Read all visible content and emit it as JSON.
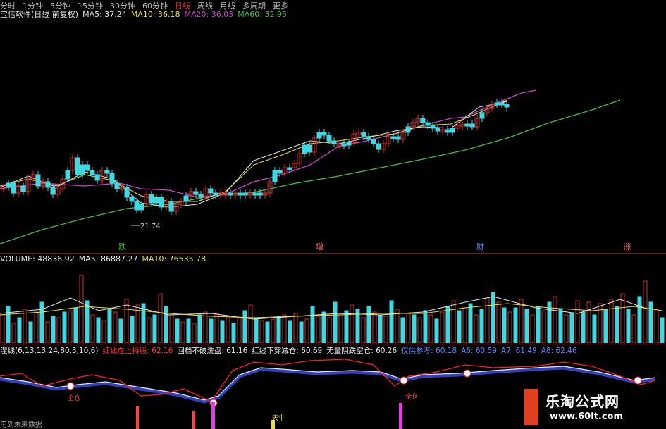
{
  "top_tabs": {
    "items": [
      "分时",
      "1分钟",
      "5分钟",
      "15分钟",
      "30分钟",
      "60分钟",
      "日线",
      "周线",
      "月线",
      "多周期",
      "更多"
    ],
    "selected": "日线"
  },
  "price_panel": {
    "title": "宝信软件(日线 前复权)",
    "ma5": "MA5: 37.24",
    "ma10": "MA10: 36.18",
    "ma20": "MA20: 36.03",
    "ma60": "MA60: 32.95",
    "low_marker": "21.74",
    "markers": [
      "跌",
      "增",
      "财",
      "涨"
    ]
  },
  "volume_panel": {
    "label": "VOLUME: 48836.92",
    "ma5": "MA5: 86887.27",
    "ma10": "MA10: 76535.78"
  },
  "indicator_panel": {
    "name": "涅线(6,13,13,24,80,3,10,6)",
    "items": [
      {
        "label": "红线在上持股:",
        "value": "62.16",
        "color": "#ff3030"
      },
      {
        "label": "回档不破洗盘:",
        "value": "61.16",
        "color": "#e6e6e6"
      },
      {
        "label": "红线下穿减仓:",
        "value": "60.69",
        "color": "#e6e6e6"
      },
      {
        "label": "无量阴跌空仓:",
        "value": "60.26",
        "color": "#e6e6e6"
      },
      {
        "label": "仅供参考:",
        "value": "60.18",
        "color": "#6080ff"
      },
      {
        "label": "A6:",
        "value": "60.59",
        "color": "#6080ff"
      },
      {
        "label": "A7:",
        "value": "61.49",
        "color": "#6080ff"
      },
      {
        "label": "A8:",
        "value": "62.46",
        "color": "#6080ff"
      }
    ],
    "signals": [
      "全仓",
      "全仓",
      "天牛"
    ]
  },
  "footer": {
    "text": "用到未来数据"
  },
  "watermark": {
    "main": "乐淘公式网",
    "url": "www.60lt.com"
  },
  "colors": {
    "up": "#d03030",
    "down": "#40d8e0",
    "ma5": "#e6e6e6",
    "ma10": "#e8e040",
    "ma20": "#d040d0",
    "ma60": "#40c040"
  }
}
